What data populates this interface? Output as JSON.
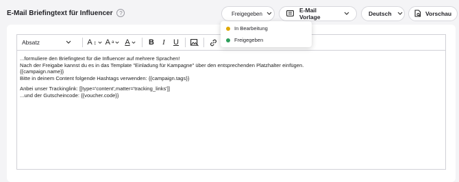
{
  "header": {
    "title": "E-Mail Briefingtext für Influencer",
    "help_icon": "?"
  },
  "status_select": {
    "value": "Freigegeben",
    "dot_color": "#2e9e5b",
    "options": [
      {
        "label": "In Bearbeitung",
        "dot_color": "#e0a800"
      },
      {
        "label": "Freigegeben",
        "dot_color": "#2e9e5b"
      }
    ]
  },
  "template_select": {
    "label": "E-Mail Vorlage"
  },
  "language_select": {
    "value": "Deutsch"
  },
  "preview_button": {
    "label": "Vorschau"
  },
  "toolbar": {
    "block_type": "Absatz",
    "font_size_glyph": "A",
    "style_glyph": "A",
    "color_glyph": "A",
    "bold": "B",
    "italic": "I",
    "underline": "U"
  },
  "content": {
    "lines": [
      "...formuliere den Briefingtext für die Influencer auf mehrere Sprachen!",
      "Nach der Freigabe kannst du es in das Template \"Einladung für Kampagne\" über den entsprechenden Platzhalter einfügen.",
      "{{campaign.name}}",
      "Bitte in deinem Content folgende Hashtags verwenden: {{campaign.tags}}"
    ],
    "lines2": [
      "Anbei unser Trackinglink: [[type='content',matter='tracking_links']]",
      "...und der Gutscheincode: {{voucher.code}}"
    ]
  }
}
